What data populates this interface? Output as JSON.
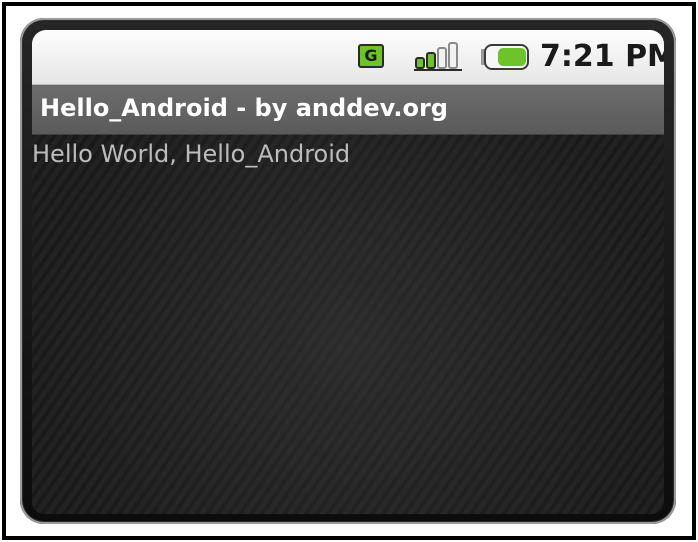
{
  "status_bar": {
    "network_type": "G",
    "time": "7:21 PM",
    "icons": [
      "network-type-icon",
      "signal-strength-icon",
      "battery-icon"
    ],
    "colors": {
      "network_badge": "#6ec22a",
      "battery_fill": "#6ec22a"
    }
  },
  "title_bar": {
    "title": "Hello_Android - by anddev.org"
  },
  "content": {
    "text": "Hello World, Hello_Android"
  }
}
